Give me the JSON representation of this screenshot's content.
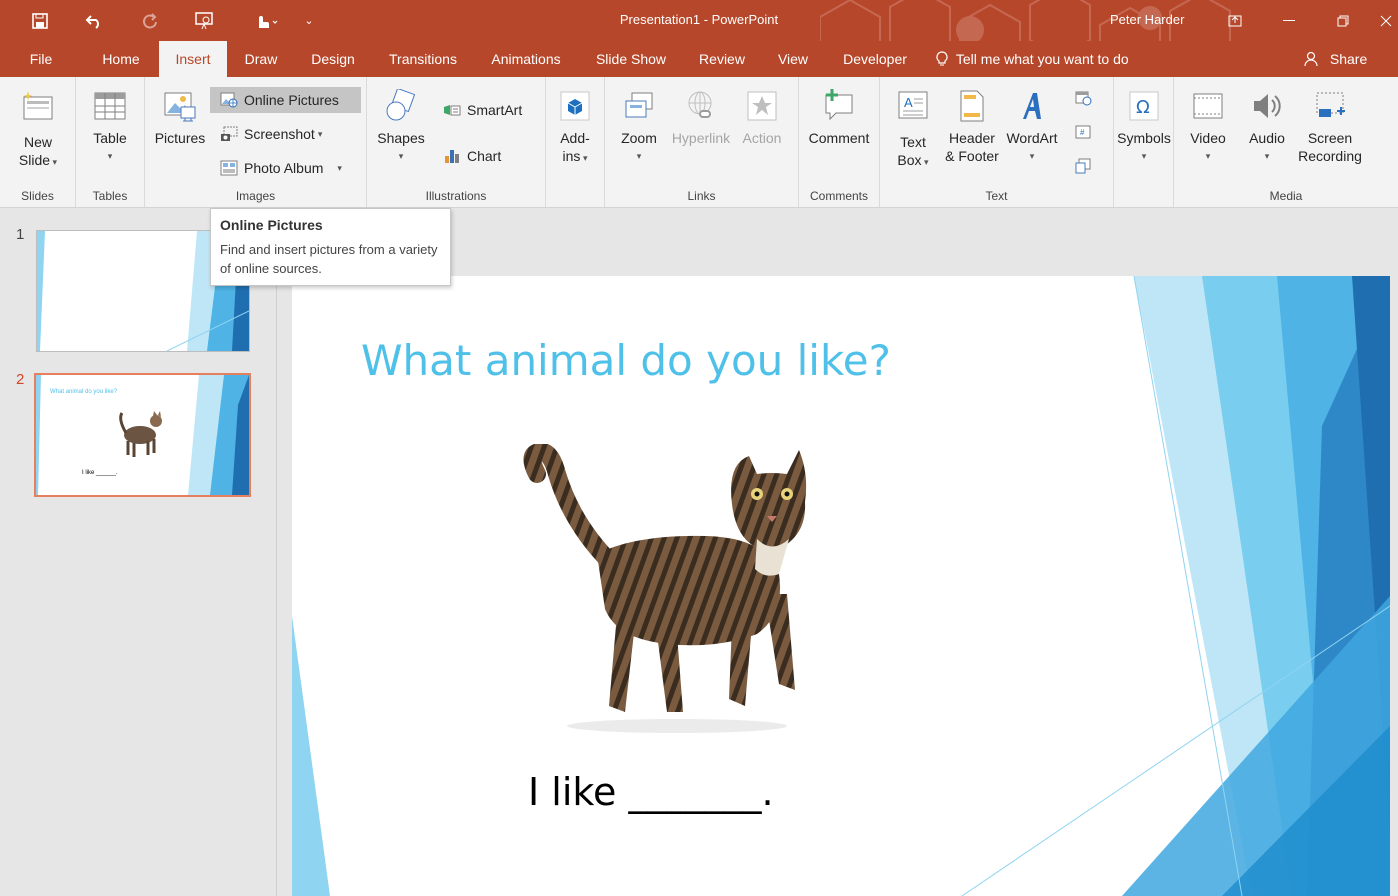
{
  "window": {
    "title": "Presentation1 - PowerPoint",
    "user": "Peter Harder",
    "accent": "#b7472a"
  },
  "quick_access": {
    "icons": [
      "save-icon",
      "undo-icon",
      "redo-icon",
      "present-icon",
      "touch-mode-icon",
      "customize-icon"
    ]
  },
  "tabs": [
    "File",
    "Home",
    "Insert",
    "Draw",
    "Design",
    "Transitions",
    "Animations",
    "Slide Show",
    "Review",
    "View",
    "Developer"
  ],
  "active_tab": "Insert",
  "tell_me": "Tell me what you want to do",
  "share": "Share",
  "ribbon": {
    "slides": {
      "label": "Slides",
      "new_slide": "New",
      "new_slide2": "Slide"
    },
    "tables": {
      "label": "Tables",
      "table": "Table"
    },
    "images": {
      "label": "Images",
      "pictures": "Pictures",
      "online_pictures": "Online Pictures",
      "screenshot": "Screenshot",
      "photo_album": "Photo Album"
    },
    "illustrations": {
      "label": "Illustrations",
      "shapes": "Shapes",
      "smartart": "SmartArt",
      "chart": "Chart"
    },
    "addins": {
      "label": "",
      "add": "Add-",
      "ins": "ins"
    },
    "links": {
      "label": "Links",
      "zoom": "Zoom",
      "hyperlink": "Hyperlink",
      "action": "Action"
    },
    "comments": {
      "label": "Comments",
      "comment": "Comment"
    },
    "text": {
      "label": "Text",
      "textbox1": "Text",
      "textbox2": "Box",
      "header1": "Header",
      "header2": "& Footer",
      "wordart": "WordArt"
    },
    "symbols": {
      "label": "",
      "symbols": "Symbols"
    },
    "media": {
      "label": "Media",
      "video": "Video",
      "audio": "Audio",
      "screen1": "Screen",
      "screen2": "Recording"
    }
  },
  "tooltip": {
    "title": "Online Pictures",
    "description": "Find and insert pictures from a variety of online sources."
  },
  "thumbnails": [
    {
      "number": "1",
      "title": "",
      "body": ""
    },
    {
      "number": "2",
      "title": "What animal do you like?",
      "body": "I like ______."
    }
  ],
  "slide": {
    "title": "What animal do you like?",
    "body": "I like _______.",
    "title_color": "#4fc1e9"
  }
}
